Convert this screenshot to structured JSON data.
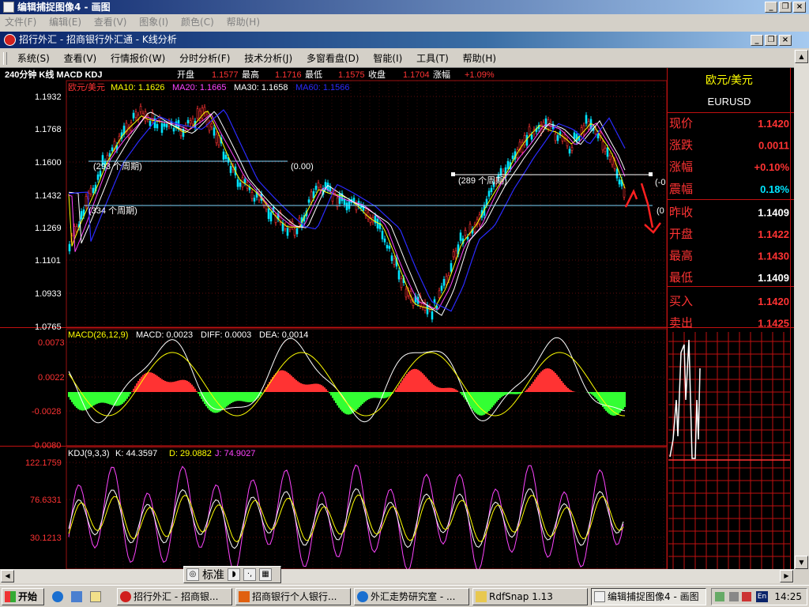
{
  "window": {
    "title": "编辑捕捉图像4 - 画图",
    "menu": [
      "文件(F)",
      "编辑(E)",
      "查看(V)",
      "图象(I)",
      "颜色(C)",
      "帮助(H)"
    ]
  },
  "app": {
    "title": "招行外汇 - 招商银行外汇通 - K线分析",
    "menu": [
      "系统(S)",
      "查看(V)",
      "行情报价(W)",
      "分时分析(F)",
      "技术分析(J)",
      "多窗看盘(D)",
      "智能(I)",
      "工具(T)",
      "帮助(H)"
    ]
  },
  "infobar": {
    "period": "240分钟 K线 MACD KDJ",
    "fields": [
      {
        "label": "开盘",
        "value": "1.1577"
      },
      {
        "label": "最高",
        "value": "1.1716"
      },
      {
        "label": "最低",
        "value": "1.1575"
      },
      {
        "label": "收盘",
        "value": "1.1704"
      },
      {
        "label": "涨幅",
        "value": "+1.09%"
      }
    ]
  },
  "main": {
    "symbol_label": "欧元/美元",
    "ma": [
      "MA10: 1.1626",
      "MA20: 1.1665",
      "MA30: 1.1658",
      "MA60: 1.1566"
    ],
    "yticks": [
      "1.1932",
      "1.1768",
      "1.1600",
      "1.1432",
      "1.1269",
      "1.1101",
      "1.0933",
      "1.0765"
    ],
    "annotations": [
      "(293 个周期)",
      "(0.00)",
      "(334 个周期)",
      "(289 个周期)",
      "(-0",
      "(0"
    ]
  },
  "macd": {
    "header": [
      "MACD(26,12,9)",
      "MACD: 0.0023",
      "DIFF: 0.0003",
      "DEA: 0.0014"
    ],
    "yticks": [
      "0.0073",
      "0.0022",
      "-0.0028",
      "-0.0080"
    ]
  },
  "kdj": {
    "header": [
      "KDJ(9,3,3)",
      "K: 44.3597",
      "D: 29.0882",
      "J: 74.9027"
    ],
    "yticks": [
      "122.1759",
      "76.6331",
      "30.1213"
    ]
  },
  "quote": {
    "name": "欧元/美元",
    "code": "EURUSD",
    "rows": [
      {
        "label": "现价",
        "value": "1.1420"
      },
      {
        "label": "涨跌",
        "value": "0.0011"
      },
      {
        "label": "涨幅",
        "value": "+0.10%"
      },
      {
        "label": "震幅",
        "value": "0.18%"
      },
      {
        "label": "昨收",
        "value": "1.1409"
      },
      {
        "label": "开盘",
        "value": "1.1422"
      },
      {
        "label": "最高",
        "value": "1.1430"
      },
      {
        "label": "最低",
        "value": "1.1409"
      },
      {
        "label": "买入",
        "value": "1.1420"
      },
      {
        "label": "卖出",
        "value": "1.1425"
      }
    ]
  },
  "ime": {
    "label": "标准"
  },
  "taskbar": {
    "start": "开始",
    "items": [
      "招行外汇 - 招商银...",
      "招商银行个人银行...",
      "外汇走势研究室 - ...",
      "RdfSnap 1.13",
      "编辑捕捉图像4 - 画图"
    ],
    "tray_lang": "En",
    "clock": "14:25"
  },
  "colors": {
    "up": "#ff3333",
    "down": "#00e5ff",
    "label_red": "#ff3333",
    "yellow": "#ffff00",
    "white": "#ffffff",
    "grid": "#7a1010"
  }
}
